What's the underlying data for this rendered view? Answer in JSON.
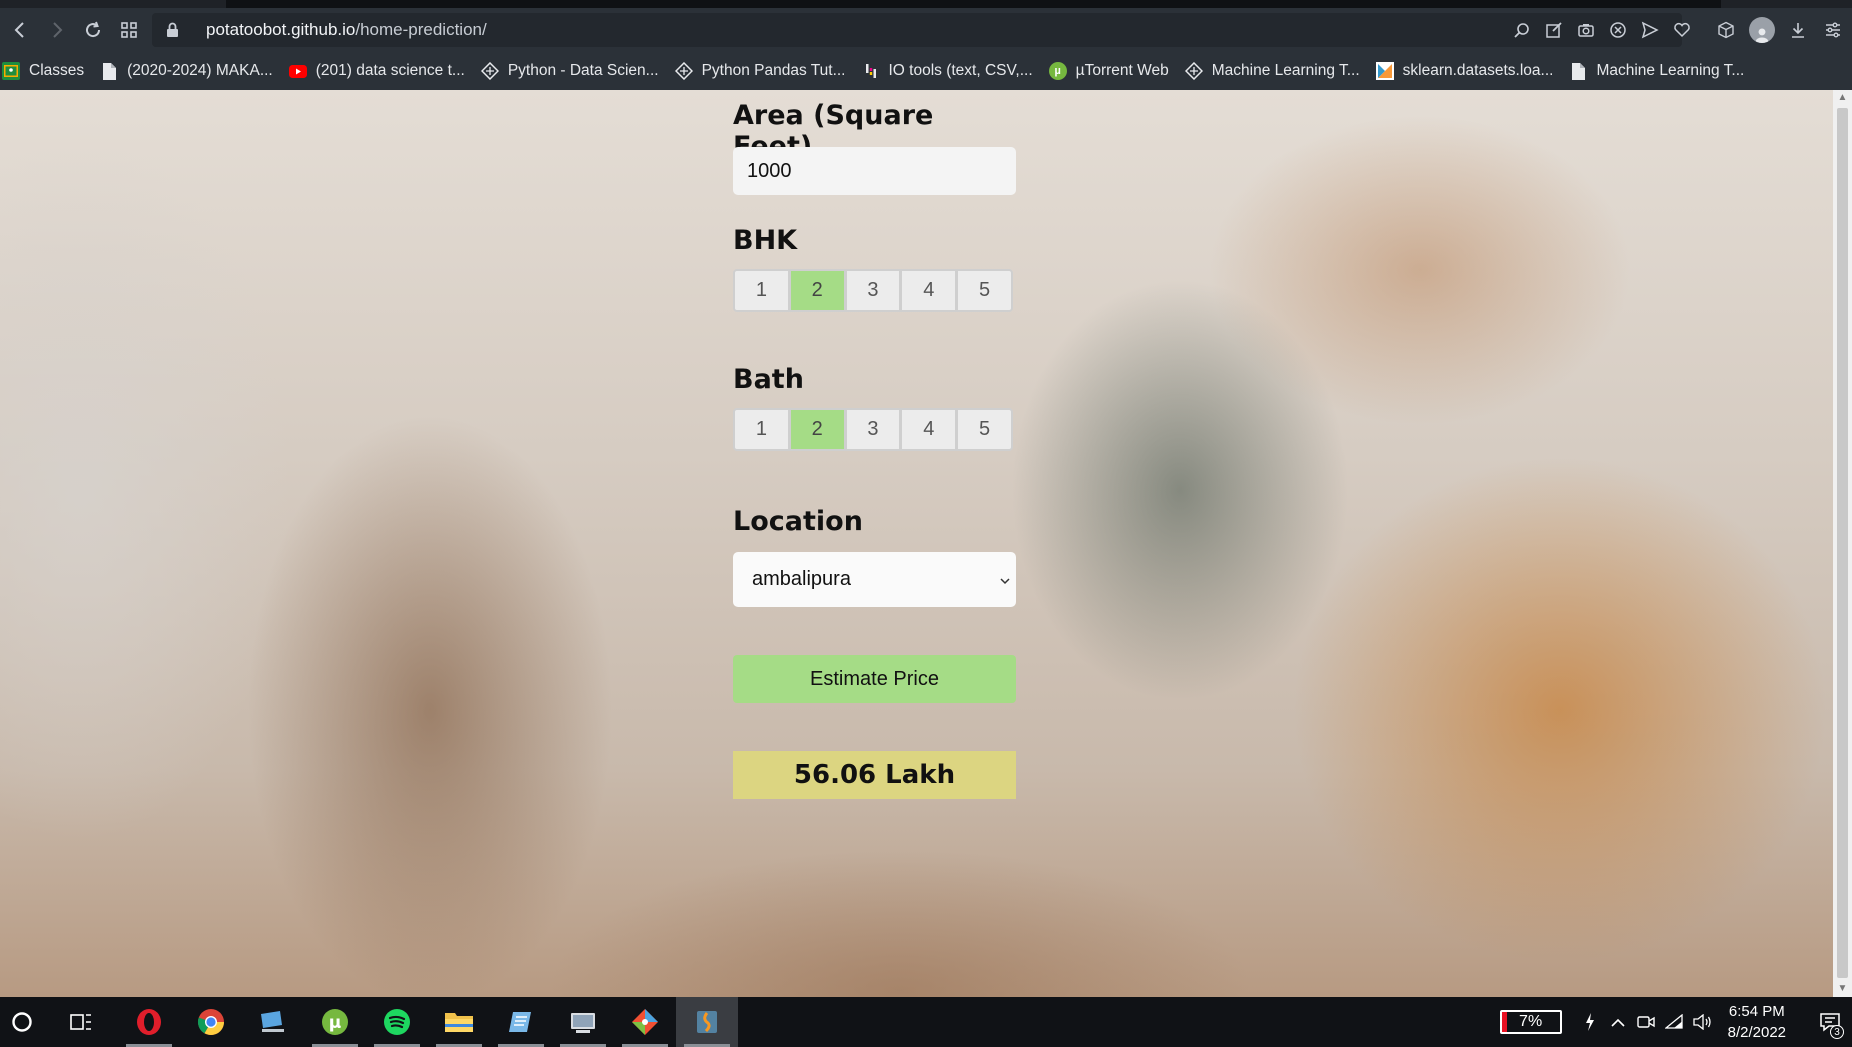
{
  "browser": {
    "url_domain": "potatoobot.github.io",
    "url_path": "/home-prediction/"
  },
  "bookmarks": [
    {
      "label": "Classes",
      "icon": "classroom-icon",
      "color": "#34a853"
    },
    {
      "label": "(2020-2024) MAKA...",
      "icon": "document-icon",
      "color": "#e8eaed"
    },
    {
      "label": "(201) data science t...",
      "icon": "youtube-icon",
      "color": "#ff0000"
    },
    {
      "label": "Python - Data Scien...",
      "icon": "geeks-icon",
      "color": "#e8eaed"
    },
    {
      "label": "Python Pandas Tut...",
      "icon": "geeks-icon",
      "color": "#e8eaed"
    },
    {
      "label": "IO tools (text, CSV,...",
      "icon": "pandas-icon",
      "color": "#150458"
    },
    {
      "label": "µTorrent Web",
      "icon": "utorrent-icon",
      "color": "#76b83f"
    },
    {
      "label": "Machine Learning T...",
      "icon": "geeks-icon",
      "color": "#e8eaed"
    },
    {
      "label": "sklearn.datasets.loa...",
      "icon": "sklearn-icon",
      "color": "#f89939"
    },
    {
      "label": "Machine Learning T...",
      "icon": "document-icon",
      "color": "#e8eaed"
    }
  ],
  "form": {
    "area_label": "Area (Square Feet)",
    "area_value": "1000",
    "bhk_label": "BHK",
    "bhk_options": [
      "1",
      "2",
      "3",
      "4",
      "5"
    ],
    "bhk_selected": "2",
    "bath_label": "Bath",
    "bath_options": [
      "1",
      "2",
      "3",
      "4",
      "5"
    ],
    "bath_selected": "2",
    "location_label": "Location",
    "location_value": "ambalipura",
    "estimate_button": "Estimate Price",
    "result": "56.06 Lakh"
  },
  "taskbar": {
    "battery": "7%",
    "time": "6:54 PM",
    "date": "8/2/2022",
    "notifications": "3"
  },
  "colors": {
    "selected_option": "#a5dc86",
    "estimate_button": "#a5dc86",
    "result_background": "#dcd581"
  }
}
